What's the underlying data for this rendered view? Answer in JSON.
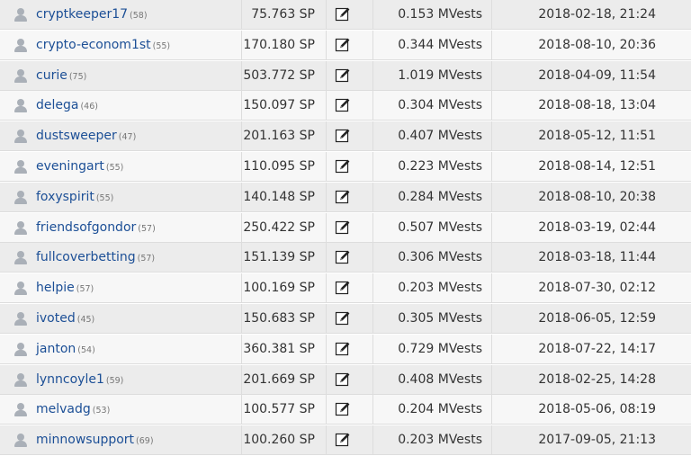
{
  "rows": [
    {
      "account": "cryptkeeper17",
      "reputation": "(58)",
      "sp": "75.763 SP",
      "mvests": "0.153 MVests",
      "date": "2018-02-18, 21:24"
    },
    {
      "account": "crypto-econom1st",
      "reputation": "(55)",
      "sp": "170.180 SP",
      "mvests": "0.344 MVests",
      "date": "2018-08-10, 20:36"
    },
    {
      "account": "curie",
      "reputation": "(75)",
      "sp": "503.772 SP",
      "mvests": "1.019 MVests",
      "date": "2018-04-09, 11:54"
    },
    {
      "account": "delega",
      "reputation": "(46)",
      "sp": "150.097 SP",
      "mvests": "0.304 MVests",
      "date": "2018-08-18, 13:04"
    },
    {
      "account": "dustsweeper",
      "reputation": "(47)",
      "sp": "201.163 SP",
      "mvests": "0.407 MVests",
      "date": "2018-05-12, 11:51"
    },
    {
      "account": "eveningart",
      "reputation": "(55)",
      "sp": "110.095 SP",
      "mvests": "0.223 MVests",
      "date": "2018-08-14, 12:51"
    },
    {
      "account": "foxyspirit",
      "reputation": "(55)",
      "sp": "140.148 SP",
      "mvests": "0.284 MVests",
      "date": "2018-08-10, 20:38"
    },
    {
      "account": "friendsofgondor",
      "reputation": "(57)",
      "sp": "250.422 SP",
      "mvests": "0.507 MVests",
      "date": "2018-03-19, 02:44"
    },
    {
      "account": "fullcoverbetting",
      "reputation": "(57)",
      "sp": "151.139 SP",
      "mvests": "0.306 MVests",
      "date": "2018-03-18, 11:44"
    },
    {
      "account": "helpie",
      "reputation": "(57)",
      "sp": "100.169 SP",
      "mvests": "0.203 MVests",
      "date": "2018-07-30, 02:12"
    },
    {
      "account": "ivoted",
      "reputation": "(45)",
      "sp": "150.683 SP",
      "mvests": "0.305 MVests",
      "date": "2018-06-05, 12:59"
    },
    {
      "account": "janton",
      "reputation": "(54)",
      "sp": "360.381 SP",
      "mvests": "0.729 MVests",
      "date": "2018-07-22, 14:17"
    },
    {
      "account": "lynncoyle1",
      "reputation": "(59)",
      "sp": "201.669 SP",
      "mvests": "0.408 MVests",
      "date": "2018-02-25, 14:28"
    },
    {
      "account": "melvadg",
      "reputation": "(53)",
      "sp": "100.577 SP",
      "mvests": "0.204 MVests",
      "date": "2018-05-06, 08:19"
    },
    {
      "account": "minnowsupport",
      "reputation": "(69)",
      "sp": "100.260 SP",
      "mvests": "0.203 MVests",
      "date": "2017-09-05, 21:13"
    }
  ],
  "icons": {
    "avatar": "user-avatar-icon",
    "edit": "edit-pencil-icon"
  },
  "colors": {
    "account_link": "#1c4f96",
    "row_odd": "#ececec",
    "row_even": "#f7f7f7"
  }
}
